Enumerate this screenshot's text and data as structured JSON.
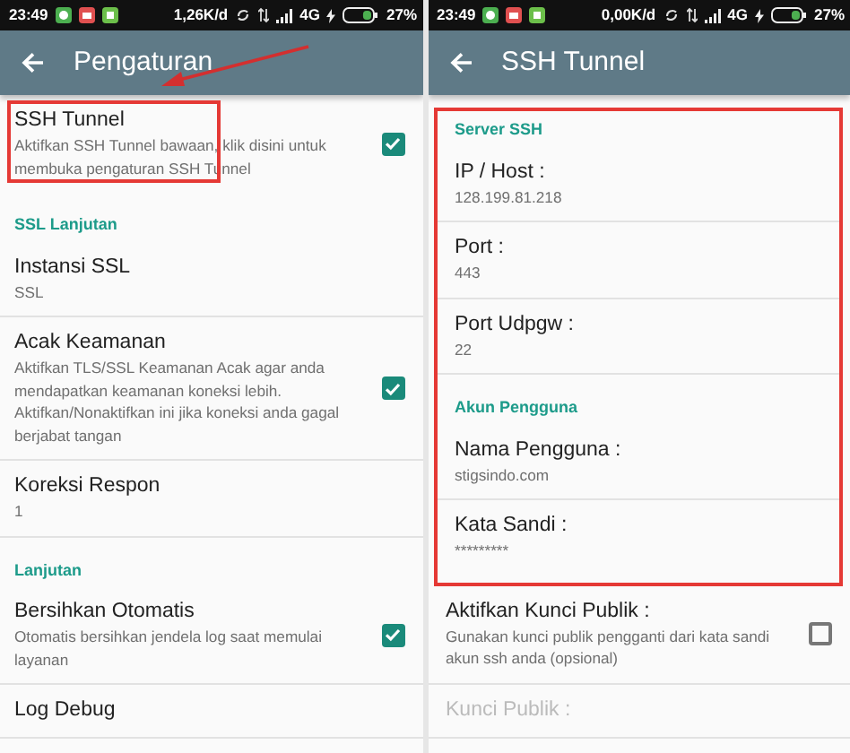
{
  "panels": [
    {
      "status_bar": {
        "time": "23:49",
        "speed": "1,26K/d",
        "network": "4G",
        "battery": "27%"
      },
      "title": "Pengaturan",
      "pointer_arrow": true,
      "items": [
        {
          "kind": "setting",
          "title": "SSH Tunnel",
          "summary": "Aktifkan SSH Tunnel bawaan, klik disini untuk membuka pengaturan SSH Tunnel",
          "checked": true,
          "highlighted": true,
          "disabled": false
        },
        {
          "kind": "header",
          "title": "SSL Lanjutan"
        },
        {
          "kind": "setting",
          "title": "Instansi SSL",
          "summary": "SSL",
          "disabled": false
        },
        {
          "kind": "setting",
          "title": "Acak Keamanan",
          "summary": "Aktifkan TLS/SSL Keamanan Acak agar anda mendapatkan keamanan koneksi lebih. Aktifkan/Nonaktifkan ini jika koneksi anda gagal berjabat tangan",
          "checked": true,
          "disabled": false
        },
        {
          "kind": "setting",
          "title": "Koreksi Respon",
          "summary": "1",
          "disabled": false
        },
        {
          "kind": "header",
          "title": "Lanjutan"
        },
        {
          "kind": "setting",
          "title": "Bersihkan Otomatis",
          "summary": "Otomatis bersihkan jendela log saat memulai layanan",
          "checked": true,
          "disabled": false
        },
        {
          "kind": "setting",
          "title": "Log Debug",
          "disabled": false
        }
      ]
    },
    {
      "status_bar": {
        "time": "23:49",
        "speed": "0,00K/d",
        "network": "4G",
        "battery": "27%"
      },
      "title": "SSH Tunnel",
      "pointer_arrow": false,
      "items": [
        {
          "kind": "group",
          "highlighted": true,
          "items": [
            {
              "kind": "header",
              "title": "Server SSH"
            },
            {
              "kind": "setting",
              "title": "IP / Host :",
              "summary": "128.199.81.218",
              "disabled": false
            },
            {
              "kind": "setting",
              "title": "Port :",
              "summary": "443",
              "disabled": false
            },
            {
              "kind": "setting",
              "title": "Port Udpgw :",
              "summary": "22",
              "disabled": false
            },
            {
              "kind": "header",
              "title": "Akun Pengguna"
            },
            {
              "kind": "setting",
              "title": "Nama Pengguna :",
              "summary": "stigsindo.com",
              "disabled": false
            },
            {
              "kind": "setting",
              "title": "Kata Sandi :",
              "summary": "*********",
              "disabled": false
            }
          ]
        },
        {
          "kind": "setting",
          "title": "Aktifkan Kunci Publik :",
          "summary": "Gunakan kunci publik pengganti dari kata sandi akun ssh anda (opsional)",
          "checked": false,
          "disabled": false
        },
        {
          "kind": "setting",
          "title": "Kunci Publik :",
          "disabled": true
        }
      ]
    }
  ]
}
